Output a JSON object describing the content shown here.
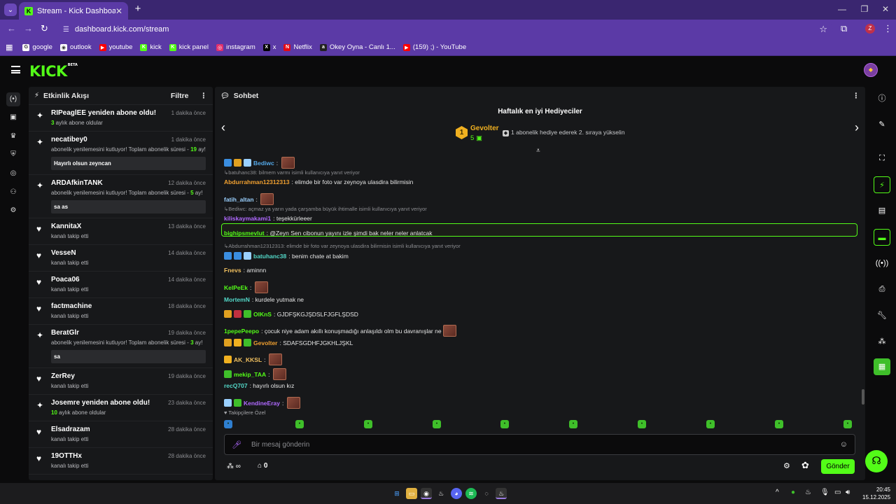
{
  "browser": {
    "tab_title": "Stream - Kick Dashboard",
    "tab_favicon": "K",
    "url": "dashboard.kick.com/stream",
    "profile_initial": "Z",
    "bookmarks": [
      {
        "label": "google",
        "icon": "google-icon",
        "color": "#ffffff",
        "glyph": "G"
      },
      {
        "label": "outlook",
        "icon": "outlook-icon",
        "color": "#ffffff",
        "glyph": "◉"
      },
      {
        "label": "youtube",
        "icon": "youtube-icon",
        "color": "#ff0000",
        "glyph": "▶"
      },
      {
        "label": "kick",
        "icon": "kick-icon",
        "color": "#53fc18",
        "glyph": "K"
      },
      {
        "label": "kick panel",
        "icon": "kick-icon",
        "color": "#53fc18",
        "glyph": "K"
      },
      {
        "label": "instagram",
        "icon": "instagram-icon",
        "color": "#e1306c",
        "glyph": "◎"
      },
      {
        "label": "x",
        "icon": "x-icon",
        "color": "#000000",
        "glyph": "X"
      },
      {
        "label": "Netflix",
        "icon": "netflix-icon",
        "color": "#e50914",
        "glyph": "N"
      },
      {
        "label": "Okey Oyna - Canlı 1...",
        "icon": "okey-icon",
        "color": "#222222",
        "glyph": "a"
      },
      {
        "label": "(159) ;) - YouTube",
        "icon": "youtube-icon",
        "color": "#ff0000",
        "glyph": "▶"
      }
    ]
  },
  "header": {
    "logo": "KICK",
    "logo_tag": "BETA"
  },
  "activity": {
    "title": "Etkinlik Akışı",
    "filter_label": "Filtre",
    "events": [
      {
        "icon": "sparkle-icon",
        "glyph": "✦",
        "name": "RIPeaglEE yeniden abone oldu!",
        "time": "1 dakika önce",
        "sub_num": "3",
        "sub": " aylık abone oldular",
        "msg": ""
      },
      {
        "icon": "sparkle-icon",
        "glyph": "✦",
        "name": "necatibey0",
        "time": "1 dakika önce",
        "sub_pre": "abonelik yenilemesini kutluyor! Toplam abonelik süresi - ",
        "sub_num": "19",
        "sub": " ay!",
        "msg": "Hayırlı olsun zeyncan"
      },
      {
        "icon": "sparkle-icon",
        "glyph": "✦",
        "name": "ARDAfkinTANK",
        "time": "12 dakika önce",
        "sub_pre": "abonelik yenilemesini kutluyor! Toplam abonelik süresi - ",
        "sub_num": "5",
        "sub": " ay!",
        "msg": "sa as"
      },
      {
        "icon": "heart-icon",
        "glyph": "♥",
        "name": "KannitaX",
        "time": "13 dakika önce",
        "sub": "kanalı takip etti",
        "msg": ""
      },
      {
        "icon": "heart-icon",
        "glyph": "♥",
        "name": "VesseN",
        "time": "14 dakika önce",
        "sub": "kanalı takip etti",
        "msg": ""
      },
      {
        "icon": "heart-icon",
        "glyph": "♥",
        "name": "Poaca06",
        "time": "14 dakika önce",
        "sub": "kanalı takip etti",
        "msg": ""
      },
      {
        "icon": "heart-icon",
        "glyph": "♥",
        "name": "factmachine",
        "time": "18 dakika önce",
        "sub": "kanalı takip etti",
        "msg": ""
      },
      {
        "icon": "sparkle-icon",
        "glyph": "✦",
        "name": "BeratGlr",
        "time": "19 dakika önce",
        "sub_pre": "abonelik yenilemesini kutluyor! Toplam abonelik süresi - ",
        "sub_num": "3",
        "sub": " ay!",
        "msg": "sa"
      },
      {
        "icon": "heart-icon",
        "glyph": "♥",
        "name": "ZerRey",
        "time": "19 dakika önce",
        "sub": "kanalı takip etti",
        "msg": ""
      },
      {
        "icon": "sparkle-icon",
        "glyph": "✦",
        "name": "Josemre yeniden abone oldu!",
        "time": "23 dakika önce",
        "sub_num": "10",
        "sub": " aylık abone oldular",
        "msg": ""
      },
      {
        "icon": "heart-icon",
        "glyph": "♥",
        "name": "Elsadrazam",
        "time": "28 dakika önce",
        "sub": "kanalı takip etti",
        "msg": ""
      },
      {
        "icon": "heart-icon",
        "glyph": "♥",
        "name": "19OTTHx",
        "time": "28 dakika önce",
        "sub": "kanalı takip etti",
        "msg": ""
      }
    ]
  },
  "chat": {
    "title": "Sohbet",
    "gifters_title": "Haftalık en iyi Hediyeciler",
    "top_gifter": {
      "rank": "1",
      "name": "Gevolter",
      "count": "5"
    },
    "gift_hint": "1 abonelik hediye ederek 2. sıraya yükselin",
    "messages": [
      {
        "kind": "msg",
        "user": "Bediwc",
        "color": "#53a8e8",
        "text": "",
        "emote": true,
        "badges": [
          "#3a8de0",
          "#e0a020",
          "#9ad0ff"
        ]
      },
      {
        "kind": "reply",
        "text": "batuhanc38: bilmem varmı isimli kullanıcıya yanıt veriyor"
      },
      {
        "kind": "msg",
        "user": "Abdurrahman12312313",
        "color": "#f0a030",
        "text": "elimde bir foto var zeynoya ulasdira bilirmisin",
        "emote": false,
        "badges": []
      },
      {
        "kind": "msg",
        "user": "fatih_altan",
        "color": "#9ad0ff",
        "text": "",
        "emote": true,
        "badges": []
      },
      {
        "kind": "reply",
        "text": "Bediwc: açmaz ya yarın yada çarşamba büyük ihtimalle isimli kullanıcıya yanıt veriyor"
      },
      {
        "kind": "msg",
        "user": "kiliskaymakami1",
        "color": "#b069ff",
        "text": "teşekkürleeer",
        "emote": false,
        "badges": []
      },
      {
        "kind": "msg",
        "user": "bighipsmevlut",
        "color": "#53fc18",
        "text": "@Zeyn Sen cibonun yayını izle şimdi bak neler neler anlatcak",
        "emote": false,
        "badges": []
      },
      {
        "kind": "reply",
        "text": "Abdurrahman12312313: elimde bir foto var zeynoya ulasdira bilirmisin isimli kullanıcıya yanıt veriyor"
      },
      {
        "kind": "msg",
        "user": "batuhanc38",
        "color": "#53d8c8",
        "text": "benim chate at bakim",
        "emote": false,
        "badges": [
          "#3a8de0",
          "#3a8de0",
          "#9ad0ff"
        ]
      },
      {
        "kind": "msg",
        "user": "Fnevs",
        "color": "#f0c060",
        "text": "aminnn",
        "emote": false,
        "badges": []
      },
      {
        "kind": "msg",
        "user": "KelPeEk",
        "color": "#53fc18",
        "text": "",
        "emote": true,
        "badges": []
      },
      {
        "kind": "msg",
        "user": "MortemN",
        "color": "#53d8c8",
        "text": "kurdele yutmak ne",
        "emote": false,
        "badges": []
      },
      {
        "kind": "msg",
        "user": "OlKnS",
        "color": "#53fc18",
        "text": "GJDFŞKGJŞDSLFJGFLŞDSD",
        "emote": false,
        "badges": [
          "#e0a020",
          "#c03040",
          "#3fbf2a"
        ]
      },
      {
        "kind": "msg",
        "user": "1pepePeepo",
        "color": "#53fc18",
        "text": "çocuk niye adam akıllı konuşmadığı anlaşıldı olm bu davranışlar ne",
        "emote": true,
        "badges": []
      },
      {
        "kind": "msg",
        "user": "Gevolter",
        "color": "#f0a030",
        "text": "SDAFSGDHFJGKHLJŞKL",
        "emote": false,
        "badges": [
          "#e0a020",
          "#f0b020",
          "#3fbf2a"
        ]
      },
      {
        "kind": "msg",
        "user": "AK_KKSL",
        "color": "#f0c060",
        "text": "",
        "emote": true,
        "badges": [
          "#f0b020"
        ]
      },
      {
        "kind": "msg",
        "user": "mekip_TAA",
        "color": "#53fc18",
        "text": "",
        "emote": true,
        "badges": [
          "#3fbf2a"
        ]
      },
      {
        "kind": "msg",
        "user": "recQ707",
        "color": "#53d8c8",
        "text": "hayırlı olsun kız",
        "emote": false,
        "badges": []
      },
      {
        "kind": "msg",
        "user": "KendineEray",
        "color": "#b069ff",
        "text": "",
        "emote": true,
        "badges": [
          "#9ad0ff",
          "#3fbf2a"
        ]
      }
    ],
    "followers_only": "Takipçilere Özel",
    "input_placeholder": "Bir mesaj gönderin",
    "points_symbol": "∞",
    "shop_count": "0",
    "send_label": "Gönder"
  },
  "taskbar": {
    "time": "20:45",
    "date": "15.12.2025"
  }
}
